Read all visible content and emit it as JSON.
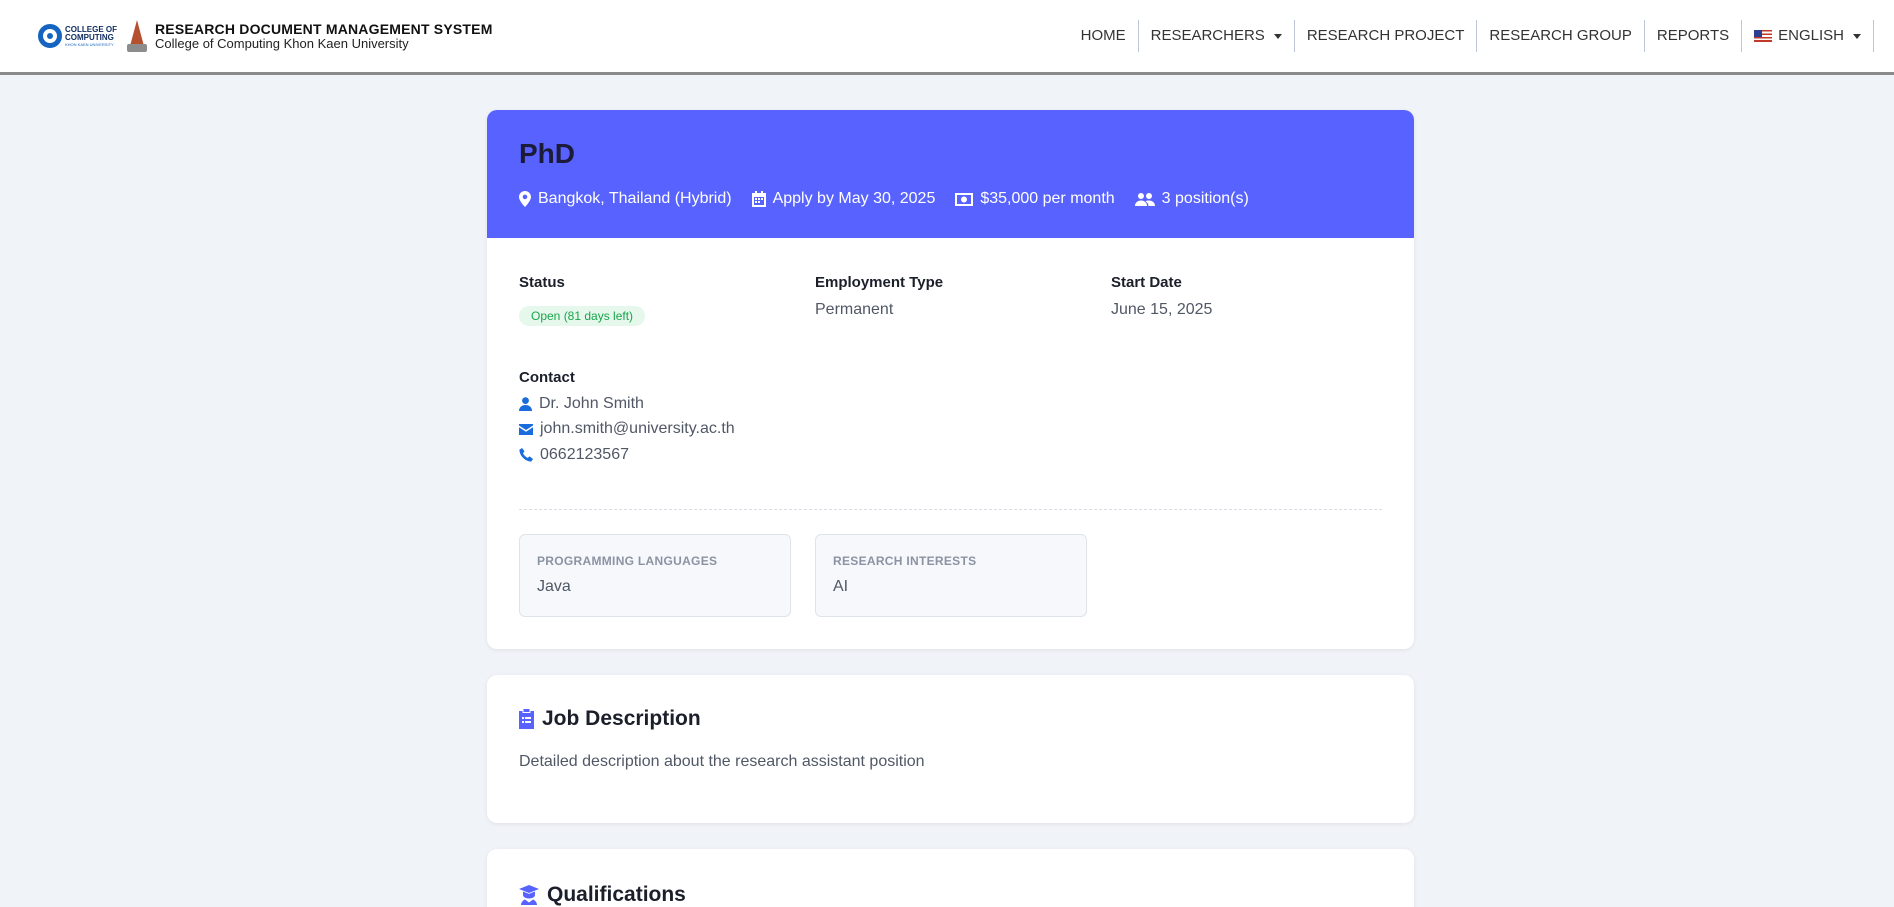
{
  "header": {
    "logo_cc_line1": "COLLEGE OF",
    "logo_cc_line2": "COMPUTING",
    "logo_cc_line3": "KHON KAEN UNIVERSITY",
    "title": "RESEARCH DOCUMENT MANAGEMENT SYSTEM",
    "subtitle": "College of Computing Khon Kaen University"
  },
  "nav": {
    "home": "HOME",
    "researchers": "RESEARCHERS",
    "research_project": "RESEARCH PROJECT",
    "research_group": "RESEARCH GROUP",
    "reports": "REPORTS",
    "language": "ENGLISH"
  },
  "job": {
    "title": "PhD",
    "location": "Bangkok, Thailand (Hybrid)",
    "apply_by": "Apply by May 30, 2025",
    "salary": "$35,000 per month",
    "positions": "3 position(s)",
    "status_label": "Status",
    "status_value": "Open (81 days left)",
    "employment_label": "Employment Type",
    "employment_value": "Permanent",
    "start_label": "Start Date",
    "start_value": "June 15, 2025",
    "contact_label": "Contact",
    "contact_name": "Dr. John Smith",
    "contact_email": "john.smith@university.ac.th",
    "contact_phone": "0662123567",
    "programming_label": "PROGRAMMING LANGUAGES",
    "programming_value": "Java",
    "interests_label": "RESEARCH INTERESTS",
    "interests_value": "AI"
  },
  "description": {
    "title": "Job Description",
    "text": "Detailed description about the research assistant position"
  },
  "qualifications": {
    "title": "Qualifications"
  },
  "colors": {
    "accent": "#5762ff",
    "status_green": "#19a54b",
    "icon_blue": "#1a6bdc"
  },
  "icons": [
    "map-marker-icon",
    "calendar-icon",
    "money-icon",
    "users-icon",
    "user-icon",
    "envelope-icon",
    "phone-icon",
    "clipboard-list-icon",
    "graduate-icon",
    "chevron-down-icon",
    "us-flag-icon"
  ]
}
